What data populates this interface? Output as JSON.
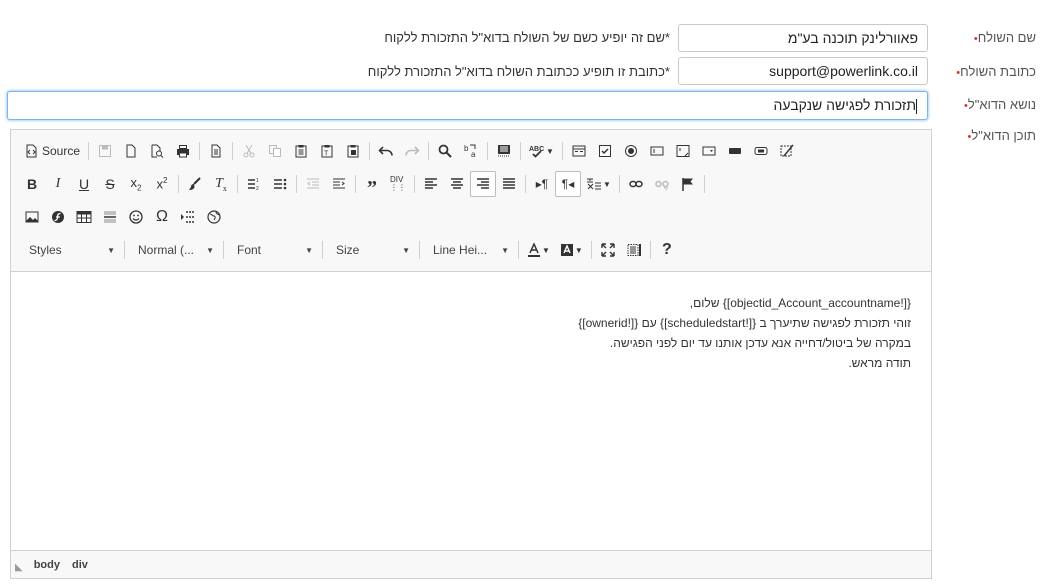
{
  "form": {
    "sender_name": {
      "label": "שם השולח",
      "value": "פאוורלינק תוכנה בע\"מ",
      "hint": "*שם זה יופיע כשם של השולח בדוא\"ל התזכורת ללקוח"
    },
    "sender_address": {
      "label": "כתובת השולח",
      "value": "support@powerlink.co.il",
      "hint": "*כתובת זו תופיע ככתובת השולח בדוא\"ל התזכורת ללקוח"
    },
    "subject": {
      "label": "נושא הדוא\"ל",
      "value": "תזכורת לפגישה שנקבעה"
    },
    "content": {
      "label": "תוכן הדוא\"ל"
    },
    "required_mark": "•"
  },
  "editor": {
    "source_label": "Source",
    "combos": {
      "styles": "Styles",
      "format": "Normal (...",
      "font": "Font",
      "size": "Size",
      "line_height": "Line Hei..."
    },
    "body_lines": [
      "{[!objectid_Account_accountname]} שלום,",
      "זוהי תזכורת לפגישה שתיערך ב {[!scheduledstart]} עם {[!ownerid]}",
      "במקרה של ביטול/דחייה אנא עדכן אותנו עד יום לפני הפגישה.",
      "תודה מראש."
    ],
    "path": [
      "body",
      "div"
    ]
  }
}
